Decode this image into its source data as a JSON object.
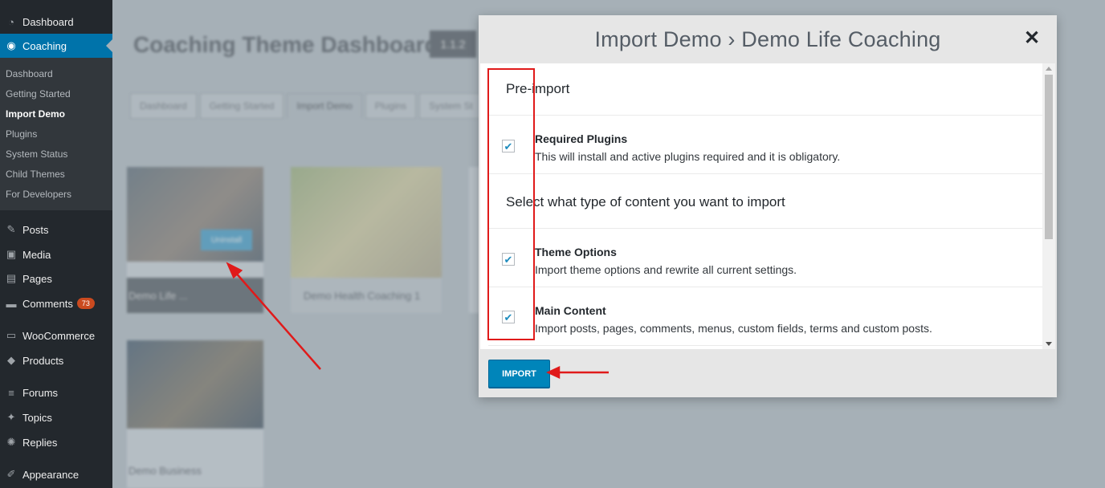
{
  "sidebar": {
    "items": [
      {
        "label": "Dashboard",
        "icon": "dashboard-icon",
        "glyph": "◔"
      },
      {
        "label": "Coaching",
        "icon": "coaching-icon",
        "glyph": "◉"
      },
      {
        "label": "Posts",
        "icon": "pin-icon",
        "glyph": "✎"
      },
      {
        "label": "Media",
        "icon": "media-icon",
        "glyph": "▣"
      },
      {
        "label": "Pages",
        "icon": "pages-icon",
        "glyph": "▤"
      },
      {
        "label": "Comments",
        "icon": "comments-icon",
        "glyph": "▬"
      },
      {
        "label": "WooCommerce",
        "icon": "woocommerce-icon",
        "glyph": "▭"
      },
      {
        "label": "Products",
        "icon": "products-icon",
        "glyph": "◆"
      },
      {
        "label": "Forums",
        "icon": "forums-icon",
        "glyph": "≡"
      },
      {
        "label": "Topics",
        "icon": "topics-icon",
        "glyph": "✦"
      },
      {
        "label": "Replies",
        "icon": "replies-icon",
        "glyph": "✺"
      },
      {
        "label": "Appearance",
        "icon": "appearance-icon",
        "glyph": "✐"
      }
    ],
    "comments_count": "73",
    "submenu": [
      "Dashboard",
      "Getting Started",
      "Import Demo",
      "Plugins",
      "System Status",
      "Child Themes",
      "For Developers"
    ]
  },
  "background": {
    "title": "Coaching Theme Dashboard",
    "version": "1.1.2",
    "tabs": [
      "Dashboard",
      "Getting Started",
      "Import Demo",
      "Plugins",
      "System St"
    ],
    "demos": [
      {
        "label": "Demo Life ...",
        "button": "Uninstall"
      },
      {
        "label": "Demo Health Coaching 1"
      },
      {
        "label": "Demo Business"
      }
    ]
  },
  "modal": {
    "title": "Import Demo › Demo Life Coaching",
    "close_glyph": "✕",
    "pre_import_heading": "Pre-import",
    "content_heading": "Select what type of content you want to import",
    "options": [
      {
        "title": "Required Plugins",
        "desc": "This will install and active plugins required and it is obligatory.",
        "checked": true
      },
      {
        "title": "Theme Options",
        "desc": "Import theme options and rewrite all current settings.",
        "checked": true
      },
      {
        "title": "Main Content",
        "desc": "Import posts, pages, comments, menus, custom fields, terms and custom posts.",
        "checked": true
      }
    ],
    "check_glyph": "✔",
    "import_label": "IMPORT"
  },
  "colors": {
    "sidebar_bg": "#23282d",
    "accent": "#0073aa",
    "annotation_red": "#e01a1a"
  }
}
